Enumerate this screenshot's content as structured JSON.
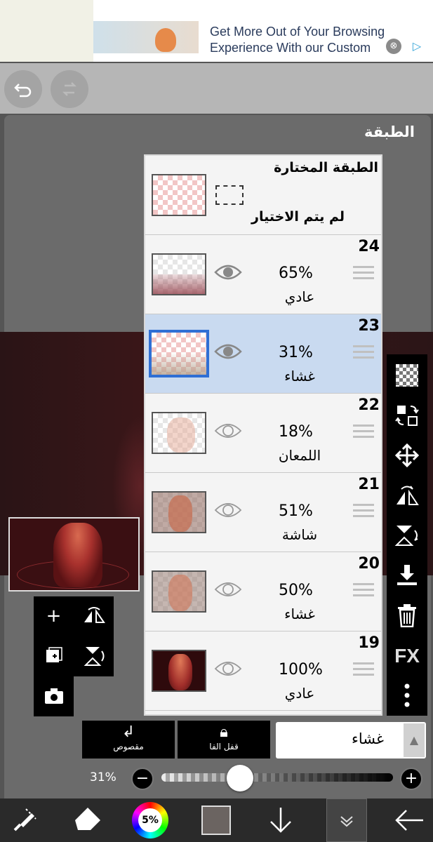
{
  "ad": {
    "text": "Get More Out of Your Browsing Experience With our Custom",
    "close_glyph": "⊗",
    "choices_glyph": "▷"
  },
  "topbar": {
    "undo_icon": "undo-icon",
    "redo_icon": "redo-icon"
  },
  "panel": {
    "title": "الطبقة"
  },
  "selection": {
    "title": "الطبقة المختارة",
    "status": "لم يتم الاختيار"
  },
  "layers": [
    {
      "number": "24",
      "opacity": "65%",
      "blend": "عادي",
      "visible": true,
      "selected": false
    },
    {
      "number": "23",
      "opacity": "31%",
      "blend": "غشاء",
      "visible": true,
      "selected": true
    },
    {
      "number": "22",
      "opacity": "18%",
      "blend": "اللمعان",
      "visible": false,
      "selected": false
    },
    {
      "number": "21",
      "opacity": "51%",
      "blend": "شاشة",
      "visible": false,
      "selected": false
    },
    {
      "number": "20",
      "opacity": "50%",
      "blend": "غشاء",
      "visible": false,
      "selected": false
    },
    {
      "number": "19",
      "opacity": "100%",
      "blend": "عادي",
      "visible": false,
      "selected": false
    }
  ],
  "right_tools": [
    "checker-icon",
    "swap-icon",
    "move-icon",
    "flip-h-icon",
    "flip-v-icon",
    "merge-down-icon",
    "trash-icon",
    "fx-icon",
    "more-icon"
  ],
  "right_tools_fx_label": "FX",
  "bottom_controls": {
    "clip_label": "مقصوص",
    "alpha_lock_label": "قفل الفا",
    "blend_value": "غشاء"
  },
  "opacity": {
    "label": "31%",
    "value": 0.31,
    "minus": "−",
    "plus": "+"
  },
  "bottom_nav": {
    "color_wheel_label": "5%",
    "swatch_color": "#6b6461"
  },
  "colors": {
    "selected_row": "#c9daf0",
    "selected_border": "#2f6fd4"
  }
}
